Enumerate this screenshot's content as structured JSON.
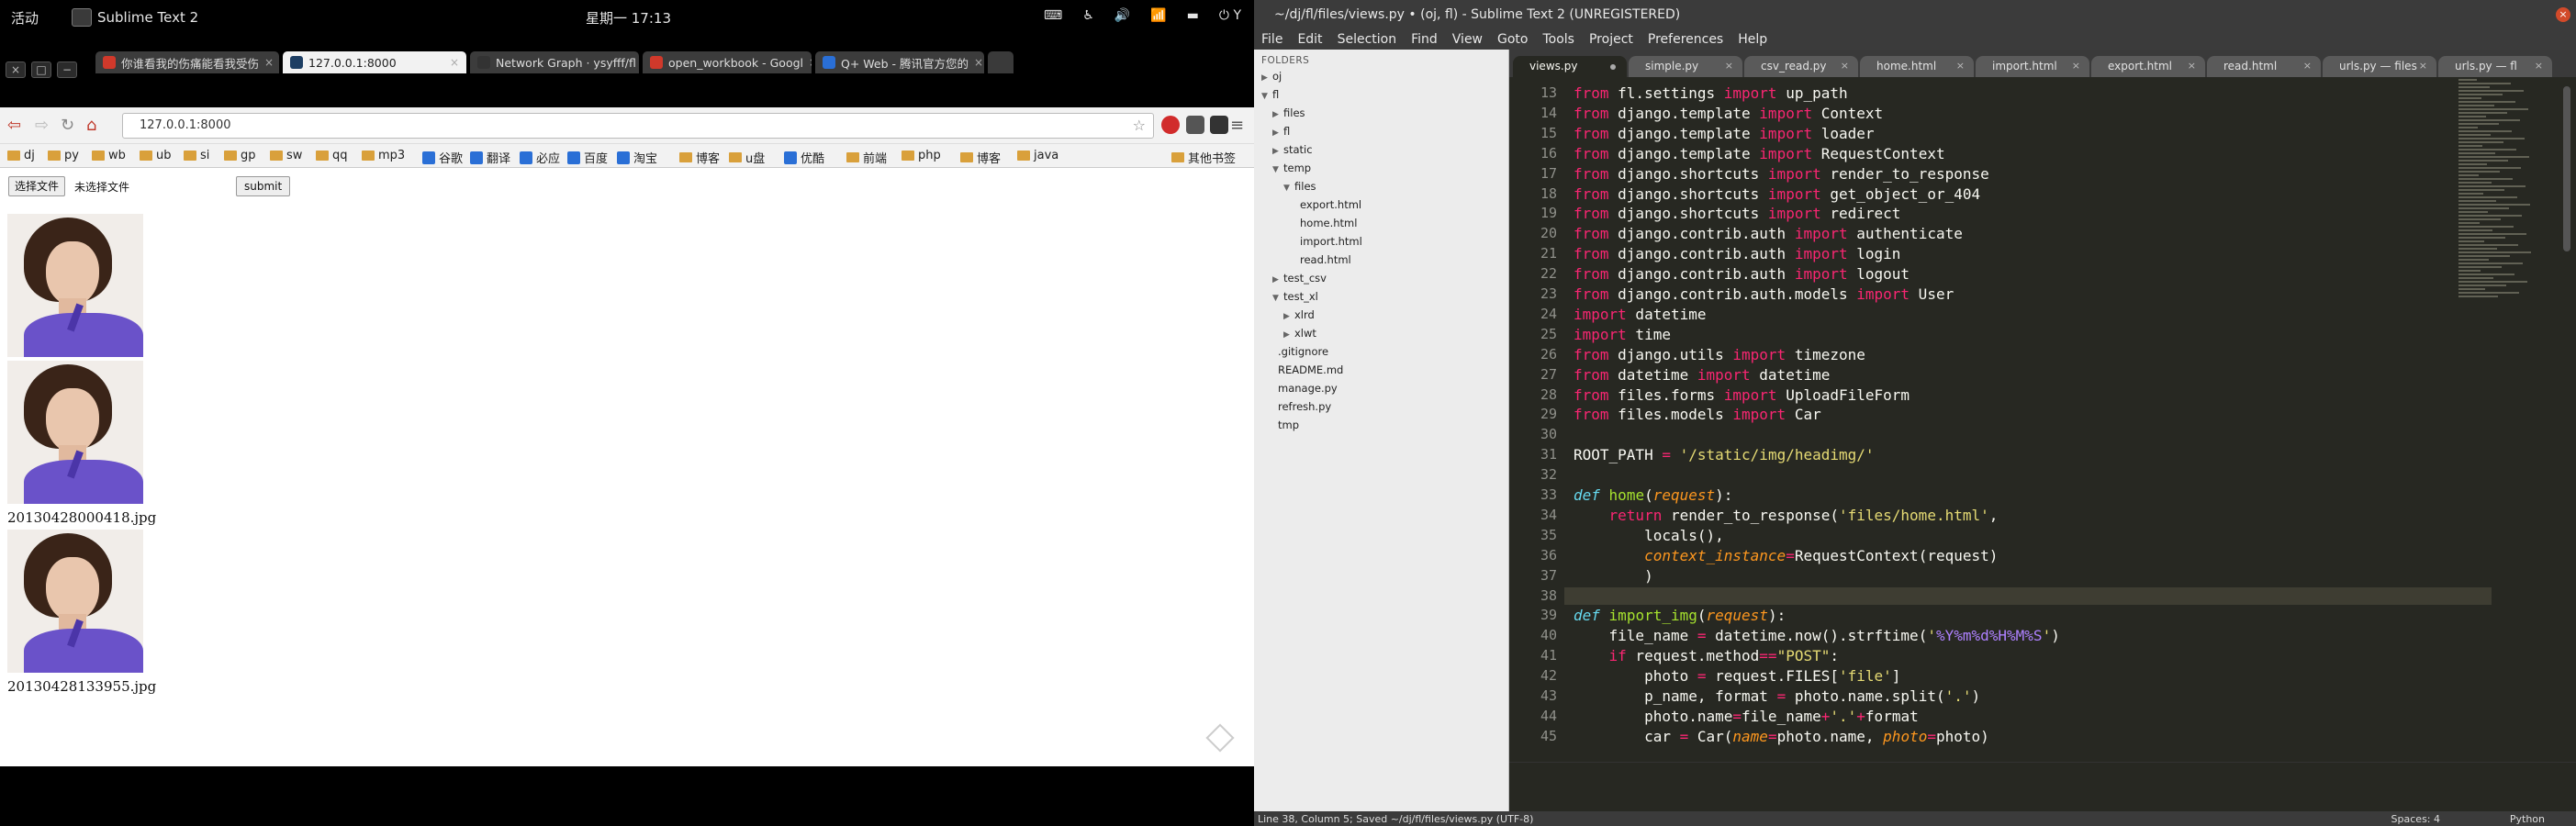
{
  "gnome": {
    "activities": "活动",
    "app_name": "Sublime Text 2",
    "clock": "星期一 17:13",
    "tray_last": "Y"
  },
  "browser": {
    "tabs": [
      {
        "label": "你谁看我的伤痛能看我受伤",
        "icon_color": "#d0392b"
      },
      {
        "label": "127.0.0.1:8000",
        "icon_color": "#1d3e63"
      },
      {
        "label": "Network Graph · ysyfff/fl",
        "icon_color": "#333333"
      },
      {
        "label": "open_workbook - Googl",
        "icon_color": "#d0392b"
      },
      {
        "label": "Q+ Web - 腾讯官方您的",
        "icon_color": "#2a6fd6"
      }
    ],
    "url": "127.0.0.1:8000",
    "bookmarks": [
      {
        "label": "dj",
        "icon": "folder"
      },
      {
        "label": "py",
        "icon": "folder"
      },
      {
        "label": "wb",
        "icon": "folder"
      },
      {
        "label": "ub",
        "icon": "folder"
      },
      {
        "label": "si",
        "icon": "folder"
      },
      {
        "label": "gp",
        "icon": "folder"
      },
      {
        "label": "sw",
        "icon": "folder"
      },
      {
        "label": "qq",
        "icon": "folder"
      },
      {
        "label": "mp3",
        "icon": "folder"
      },
      {
        "label": "谷歌",
        "icon": "site"
      },
      {
        "label": "翻译",
        "icon": "site"
      },
      {
        "label": "必应",
        "icon": "site"
      },
      {
        "label": "百度",
        "icon": "site"
      },
      {
        "label": "淘宝",
        "icon": "site"
      },
      {
        "label": "博客",
        "icon": "folder"
      },
      {
        "label": "u盘",
        "icon": "folder"
      },
      {
        "label": "优酷",
        "icon": "site"
      },
      {
        "label": "前端",
        "icon": "folder"
      },
      {
        "label": "php",
        "icon": "folder"
      },
      {
        "label": "博客",
        "icon": "folder"
      },
      {
        "label": "java",
        "icon": "folder"
      }
    ],
    "other_bookmarks": "其他书签",
    "page": {
      "choose_file": "选择文件",
      "no_file": "未选择文件",
      "submit": "submit",
      "captions": [
        "20130428000418.jpg",
        "20130428133955.jpg"
      ]
    }
  },
  "sublime": {
    "title": "~/dj/fl/files/views.py • (oj, fl) - Sublime Text 2 (UNREGISTERED)",
    "menu": [
      "File",
      "Edit",
      "Selection",
      "Find",
      "View",
      "Goto",
      "Tools",
      "Project",
      "Preferences",
      "Help"
    ],
    "sidebar_header": "FOLDERS",
    "tree": [
      {
        "label": "oj",
        "depth": 0,
        "arrow": "closed"
      },
      {
        "label": "fl",
        "depth": 0,
        "arrow": "open"
      },
      {
        "label": "files",
        "depth": 1,
        "arrow": "closed"
      },
      {
        "label": "fl",
        "depth": 1,
        "arrow": "closed"
      },
      {
        "label": "static",
        "depth": 1,
        "arrow": "closed"
      },
      {
        "label": "temp",
        "depth": 1,
        "arrow": "open"
      },
      {
        "label": "files",
        "depth": 2,
        "arrow": "open"
      },
      {
        "label": "export.html",
        "depth": 3,
        "arrow": "none"
      },
      {
        "label": "home.html",
        "depth": 3,
        "arrow": "none"
      },
      {
        "label": "import.html",
        "depth": 3,
        "arrow": "none"
      },
      {
        "label": "read.html",
        "depth": 3,
        "arrow": "none"
      },
      {
        "label": "test_csv",
        "depth": 1,
        "arrow": "closed"
      },
      {
        "label": "test_xl",
        "depth": 1,
        "arrow": "open"
      },
      {
        "label": "xlrd",
        "depth": 2,
        "arrow": "closed"
      },
      {
        "label": "xlwt",
        "depth": 2,
        "arrow": "closed"
      },
      {
        "label": ".gitignore",
        "depth": 1,
        "arrow": "none"
      },
      {
        "label": "README.md",
        "depth": 1,
        "arrow": "none"
      },
      {
        "label": "manage.py",
        "depth": 1,
        "arrow": "none"
      },
      {
        "label": "refresh.py",
        "depth": 1,
        "arrow": "none"
      },
      {
        "label": "tmp",
        "depth": 1,
        "arrow": "none"
      }
    ],
    "tabs": [
      {
        "label": "views.py",
        "modified": true
      },
      {
        "label": "simple.py"
      },
      {
        "label": "csv_read.py"
      },
      {
        "label": "home.html"
      },
      {
        "label": "import.html"
      },
      {
        "label": "export.html"
      },
      {
        "label": "read.html"
      },
      {
        "label": "urls.py — files"
      },
      {
        "label": "urls.py — fl"
      }
    ],
    "first_line": 13,
    "current_line": 38,
    "code": [
      [
        [
          "from",
          "kw"
        ],
        [
          " fl.settings ",
          ""
        ],
        [
          "import",
          "kw"
        ],
        [
          " up_path",
          ""
        ]
      ],
      [
        [
          "from",
          "kw"
        ],
        [
          " django.template ",
          ""
        ],
        [
          "import",
          "kw"
        ],
        [
          " Context",
          ""
        ]
      ],
      [
        [
          "from",
          "kw"
        ],
        [
          " django.template ",
          ""
        ],
        [
          "import",
          "kw"
        ],
        [
          " loader",
          ""
        ]
      ],
      [
        [
          "from",
          "kw"
        ],
        [
          " django.template ",
          ""
        ],
        [
          "import",
          "kw"
        ],
        [
          " RequestContext",
          ""
        ]
      ],
      [
        [
          "from",
          "kw"
        ],
        [
          " django.shortcuts ",
          ""
        ],
        [
          "import",
          "kw"
        ],
        [
          " render_to_response",
          ""
        ]
      ],
      [
        [
          "from",
          "kw"
        ],
        [
          " django.shortcuts ",
          ""
        ],
        [
          "import",
          "kw"
        ],
        [
          " get_object_or_404",
          ""
        ]
      ],
      [
        [
          "from",
          "kw"
        ],
        [
          " django.shortcuts ",
          ""
        ],
        [
          "import",
          "kw"
        ],
        [
          " redirect",
          ""
        ]
      ],
      [
        [
          "from",
          "kw"
        ],
        [
          " django.contrib.auth ",
          ""
        ],
        [
          "import",
          "kw"
        ],
        [
          " authenticate",
          ""
        ]
      ],
      [
        [
          "from",
          "kw"
        ],
        [
          " django.contrib.auth ",
          ""
        ],
        [
          "import",
          "kw"
        ],
        [
          " login",
          ""
        ]
      ],
      [
        [
          "from",
          "kw"
        ],
        [
          " django.contrib.auth ",
          ""
        ],
        [
          "import",
          "kw"
        ],
        [
          " logout",
          ""
        ]
      ],
      [
        [
          "from",
          "kw"
        ],
        [
          " django.contrib.auth.models ",
          ""
        ],
        [
          "import",
          "kw"
        ],
        [
          " User",
          ""
        ]
      ],
      [
        [
          "import",
          "kw"
        ],
        [
          " datetime",
          ""
        ]
      ],
      [
        [
          "import",
          "kw"
        ],
        [
          " time",
          ""
        ]
      ],
      [
        [
          "from",
          "kw"
        ],
        [
          " django.utils ",
          ""
        ],
        [
          "import",
          "kw"
        ],
        [
          " timezone",
          ""
        ]
      ],
      [
        [
          "from",
          "kw"
        ],
        [
          " datetime ",
          ""
        ],
        [
          "import",
          "kw"
        ],
        [
          " datetime",
          ""
        ]
      ],
      [
        [
          "from",
          "kw"
        ],
        [
          " files.forms ",
          ""
        ],
        [
          "import",
          "kw"
        ],
        [
          " UploadFileForm",
          ""
        ]
      ],
      [
        [
          "from",
          "kw"
        ],
        [
          " files.models ",
          ""
        ],
        [
          "import",
          "kw"
        ],
        [
          " Car",
          ""
        ]
      ],
      [],
      [
        [
          "ROOT_PATH ",
          ""
        ],
        [
          "=",
          "kw"
        ],
        [
          " ",
          ""
        ],
        [
          "'/static/img/headimg/'",
          "st"
        ]
      ],
      [],
      [
        [
          "def",
          "df"
        ],
        [
          " ",
          ""
        ],
        [
          "home",
          "fn"
        ],
        [
          "(",
          ""
        ],
        [
          "request",
          "pa"
        ],
        [
          "):",
          ""
        ]
      ],
      [
        [
          "    ",
          ""
        ],
        [
          "return",
          "kw"
        ],
        [
          " render_to_response(",
          ""
        ],
        [
          "'files/home.html'",
          "st"
        ],
        [
          ",",
          ""
        ]
      ],
      [
        [
          "        locals(),",
          ""
        ]
      ],
      [
        [
          "        ",
          ""
        ],
        [
          "context_instance",
          "pa"
        ],
        [
          "=",
          "kw"
        ],
        [
          "RequestContext(request)",
          ""
        ]
      ],
      [
        [
          "        )",
          ""
        ]
      ],
      [
        [
          "    ",
          ""
        ]
      ],
      [
        [
          "def",
          "df"
        ],
        [
          " ",
          ""
        ],
        [
          "import_img",
          "fn"
        ],
        [
          "(",
          ""
        ],
        [
          "request",
          "pa"
        ],
        [
          "):",
          ""
        ]
      ],
      [
        [
          "    file_name ",
          ""
        ],
        [
          "=",
          "kw"
        ],
        [
          " datetime.now().strftime(",
          ""
        ],
        [
          "'",
          "st"
        ],
        [
          "%Y%m%d%H%M%S",
          "pct"
        ],
        [
          "'",
          "st"
        ],
        [
          ")",
          ""
        ]
      ],
      [
        [
          "    ",
          ""
        ],
        [
          "if",
          "kw"
        ],
        [
          " request.method",
          ""
        ],
        [
          "==",
          "kw"
        ],
        [
          "\"POST\"",
          "st"
        ],
        [
          ":",
          ""
        ]
      ],
      [
        [
          "        photo ",
          ""
        ],
        [
          "=",
          "kw"
        ],
        [
          " request.FILES[",
          ""
        ],
        [
          "'file'",
          "st"
        ],
        [
          "]",
          ""
        ]
      ],
      [
        [
          "        p_name, format ",
          ""
        ],
        [
          "=",
          "kw"
        ],
        [
          " photo.name.split(",
          ""
        ],
        [
          "'.'",
          "st"
        ],
        [
          ")",
          ""
        ]
      ],
      [
        [
          "        photo.name",
          ""
        ],
        [
          "=",
          "kw"
        ],
        [
          "file_name",
          ""
        ],
        [
          "+",
          "kw"
        ],
        [
          "'.'",
          "st"
        ],
        [
          "+",
          "kw"
        ],
        [
          "format",
          ""
        ]
      ],
      [
        [
          "        car ",
          ""
        ],
        [
          "=",
          "kw"
        ],
        [
          " Car(",
          ""
        ],
        [
          "name",
          "pa"
        ],
        [
          "=",
          "kw"
        ],
        [
          "photo.name, ",
          ""
        ],
        [
          "photo",
          "pa"
        ],
        [
          "=",
          "kw"
        ],
        [
          "photo)",
          ""
        ]
      ]
    ],
    "status_left": "Line 38, Column 5; Saved ~/dj/fl/files/views.py (UTF-8)",
    "status_spaces": "Spaces: 4",
    "status_syntax": "Python"
  }
}
